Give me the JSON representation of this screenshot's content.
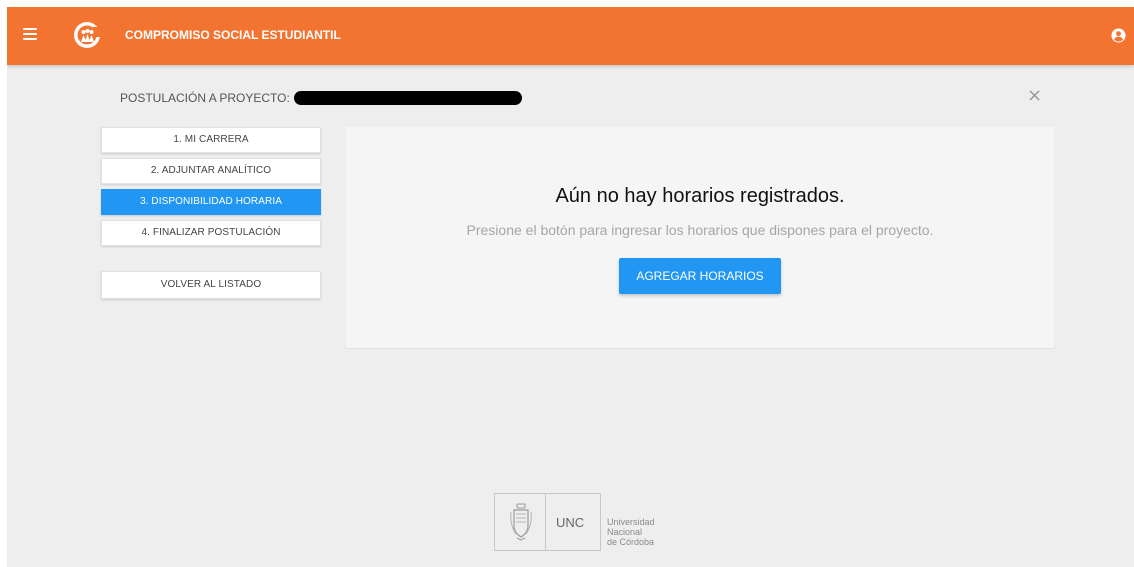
{
  "header": {
    "title": "COMPROMISO SOCIAL ESTUDIANTIL",
    "menu_icon": "hamburger-menu-icon",
    "logo_icon": "people-circle-logo",
    "user_icon": "account-circle-icon",
    "color": "#f37430"
  },
  "project": {
    "label": "POSTULACIÓN A PROYECTO:",
    "value_redacted": true
  },
  "close_icon": "×",
  "steps": [
    {
      "label": "1. MI CARRERA",
      "active": false
    },
    {
      "label": "2. ADJUNTAR ANALÍTICO",
      "active": false
    },
    {
      "label": "3. DISPONIBILIDAD HORARIA",
      "active": true
    },
    {
      "label": "4. FINALIZAR POSTULACIÓN",
      "active": false
    }
  ],
  "back_button": "VOLVER AL LISTADO",
  "panel": {
    "title": "Aún no hay horarios registrados.",
    "subtitle": "Presione el botón para ingresar los horarios que dispones para el proyecto.",
    "button": "AGREGAR HORARIOS"
  },
  "footer": {
    "abbr": "UNC",
    "line1": "Universidad",
    "line2": "Nacional",
    "line3": "de Córdoba",
    "seal_icon": "university-seal-icon"
  },
  "colors": {
    "accent": "#2196f3",
    "background": "#eeeeee",
    "panel": "#f5f5f5"
  }
}
